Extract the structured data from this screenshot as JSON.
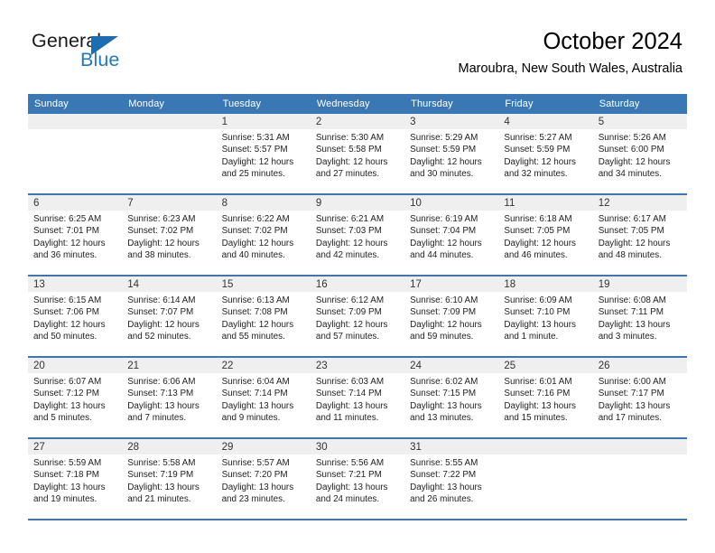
{
  "brand": {
    "name_top": "General",
    "name_bottom": "Blue",
    "accent_color": "#1b6eb3",
    "triangle_icon": "triangle-icon"
  },
  "header": {
    "title": "October 2024",
    "subtitle": "Maroubra, New South Wales, Australia"
  },
  "calendar": {
    "header_bg": "#3a78b5",
    "header_text_color": "#ffffff",
    "daynum_strip_bg": "#efefef",
    "weekday_labels": [
      "Sunday",
      "Monday",
      "Tuesday",
      "Wednesday",
      "Thursday",
      "Friday",
      "Saturday"
    ],
    "labels": {
      "sunrise": "Sunrise:",
      "sunset": "Sunset:",
      "daylight": "Daylight:"
    },
    "weeks": [
      [
        {
          "day": ""
        },
        {
          "day": ""
        },
        {
          "day": "1",
          "sunrise": "Sunrise: 5:31 AM",
          "sunset": "Sunset: 5:57 PM",
          "daylight_1": "Daylight: 12 hours",
          "daylight_2": "and 25 minutes."
        },
        {
          "day": "2",
          "sunrise": "Sunrise: 5:30 AM",
          "sunset": "Sunset: 5:58 PM",
          "daylight_1": "Daylight: 12 hours",
          "daylight_2": "and 27 minutes."
        },
        {
          "day": "3",
          "sunrise": "Sunrise: 5:29 AM",
          "sunset": "Sunset: 5:59 PM",
          "daylight_1": "Daylight: 12 hours",
          "daylight_2": "and 30 minutes."
        },
        {
          "day": "4",
          "sunrise": "Sunrise: 5:27 AM",
          "sunset": "Sunset: 5:59 PM",
          "daylight_1": "Daylight: 12 hours",
          "daylight_2": "and 32 minutes."
        },
        {
          "day": "5",
          "sunrise": "Sunrise: 5:26 AM",
          "sunset": "Sunset: 6:00 PM",
          "daylight_1": "Daylight: 12 hours",
          "daylight_2": "and 34 minutes."
        }
      ],
      [
        {
          "day": "6",
          "sunrise": "Sunrise: 6:25 AM",
          "sunset": "Sunset: 7:01 PM",
          "daylight_1": "Daylight: 12 hours",
          "daylight_2": "and 36 minutes."
        },
        {
          "day": "7",
          "sunrise": "Sunrise: 6:23 AM",
          "sunset": "Sunset: 7:02 PM",
          "daylight_1": "Daylight: 12 hours",
          "daylight_2": "and 38 minutes."
        },
        {
          "day": "8",
          "sunrise": "Sunrise: 6:22 AM",
          "sunset": "Sunset: 7:02 PM",
          "daylight_1": "Daylight: 12 hours",
          "daylight_2": "and 40 minutes."
        },
        {
          "day": "9",
          "sunrise": "Sunrise: 6:21 AM",
          "sunset": "Sunset: 7:03 PM",
          "daylight_1": "Daylight: 12 hours",
          "daylight_2": "and 42 minutes."
        },
        {
          "day": "10",
          "sunrise": "Sunrise: 6:19 AM",
          "sunset": "Sunset: 7:04 PM",
          "daylight_1": "Daylight: 12 hours",
          "daylight_2": "and 44 minutes."
        },
        {
          "day": "11",
          "sunrise": "Sunrise: 6:18 AM",
          "sunset": "Sunset: 7:05 PM",
          "daylight_1": "Daylight: 12 hours",
          "daylight_2": "and 46 minutes."
        },
        {
          "day": "12",
          "sunrise": "Sunrise: 6:17 AM",
          "sunset": "Sunset: 7:05 PM",
          "daylight_1": "Daylight: 12 hours",
          "daylight_2": "and 48 minutes."
        }
      ],
      [
        {
          "day": "13",
          "sunrise": "Sunrise: 6:15 AM",
          "sunset": "Sunset: 7:06 PM",
          "daylight_1": "Daylight: 12 hours",
          "daylight_2": "and 50 minutes."
        },
        {
          "day": "14",
          "sunrise": "Sunrise: 6:14 AM",
          "sunset": "Sunset: 7:07 PM",
          "daylight_1": "Daylight: 12 hours",
          "daylight_2": "and 52 minutes."
        },
        {
          "day": "15",
          "sunrise": "Sunrise: 6:13 AM",
          "sunset": "Sunset: 7:08 PM",
          "daylight_1": "Daylight: 12 hours",
          "daylight_2": "and 55 minutes."
        },
        {
          "day": "16",
          "sunrise": "Sunrise: 6:12 AM",
          "sunset": "Sunset: 7:09 PM",
          "daylight_1": "Daylight: 12 hours",
          "daylight_2": "and 57 minutes."
        },
        {
          "day": "17",
          "sunrise": "Sunrise: 6:10 AM",
          "sunset": "Sunset: 7:09 PM",
          "daylight_1": "Daylight: 12 hours",
          "daylight_2": "and 59 minutes."
        },
        {
          "day": "18",
          "sunrise": "Sunrise: 6:09 AM",
          "sunset": "Sunset: 7:10 PM",
          "daylight_1": "Daylight: 13 hours",
          "daylight_2": "and 1 minute."
        },
        {
          "day": "19",
          "sunrise": "Sunrise: 6:08 AM",
          "sunset": "Sunset: 7:11 PM",
          "daylight_1": "Daylight: 13 hours",
          "daylight_2": "and 3 minutes."
        }
      ],
      [
        {
          "day": "20",
          "sunrise": "Sunrise: 6:07 AM",
          "sunset": "Sunset: 7:12 PM",
          "daylight_1": "Daylight: 13 hours",
          "daylight_2": "and 5 minutes."
        },
        {
          "day": "21",
          "sunrise": "Sunrise: 6:06 AM",
          "sunset": "Sunset: 7:13 PM",
          "daylight_1": "Daylight: 13 hours",
          "daylight_2": "and 7 minutes."
        },
        {
          "day": "22",
          "sunrise": "Sunrise: 6:04 AM",
          "sunset": "Sunset: 7:14 PM",
          "daylight_1": "Daylight: 13 hours",
          "daylight_2": "and 9 minutes."
        },
        {
          "day": "23",
          "sunrise": "Sunrise: 6:03 AM",
          "sunset": "Sunset: 7:14 PM",
          "daylight_1": "Daylight: 13 hours",
          "daylight_2": "and 11 minutes."
        },
        {
          "day": "24",
          "sunrise": "Sunrise: 6:02 AM",
          "sunset": "Sunset: 7:15 PM",
          "daylight_1": "Daylight: 13 hours",
          "daylight_2": "and 13 minutes."
        },
        {
          "day": "25",
          "sunrise": "Sunrise: 6:01 AM",
          "sunset": "Sunset: 7:16 PM",
          "daylight_1": "Daylight: 13 hours",
          "daylight_2": "and 15 minutes."
        },
        {
          "day": "26",
          "sunrise": "Sunrise: 6:00 AM",
          "sunset": "Sunset: 7:17 PM",
          "daylight_1": "Daylight: 13 hours",
          "daylight_2": "and 17 minutes."
        }
      ],
      [
        {
          "day": "27",
          "sunrise": "Sunrise: 5:59 AM",
          "sunset": "Sunset: 7:18 PM",
          "daylight_1": "Daylight: 13 hours",
          "daylight_2": "and 19 minutes."
        },
        {
          "day": "28",
          "sunrise": "Sunrise: 5:58 AM",
          "sunset": "Sunset: 7:19 PM",
          "daylight_1": "Daylight: 13 hours",
          "daylight_2": "and 21 minutes."
        },
        {
          "day": "29",
          "sunrise": "Sunrise: 5:57 AM",
          "sunset": "Sunset: 7:20 PM",
          "daylight_1": "Daylight: 13 hours",
          "daylight_2": "and 23 minutes."
        },
        {
          "day": "30",
          "sunrise": "Sunrise: 5:56 AM",
          "sunset": "Sunset: 7:21 PM",
          "daylight_1": "Daylight: 13 hours",
          "daylight_2": "and 24 minutes."
        },
        {
          "day": "31",
          "sunrise": "Sunrise: 5:55 AM",
          "sunset": "Sunset: 7:22 PM",
          "daylight_1": "Daylight: 13 hours",
          "daylight_2": "and 26 minutes."
        },
        {
          "day": ""
        },
        {
          "day": ""
        }
      ]
    ]
  }
}
